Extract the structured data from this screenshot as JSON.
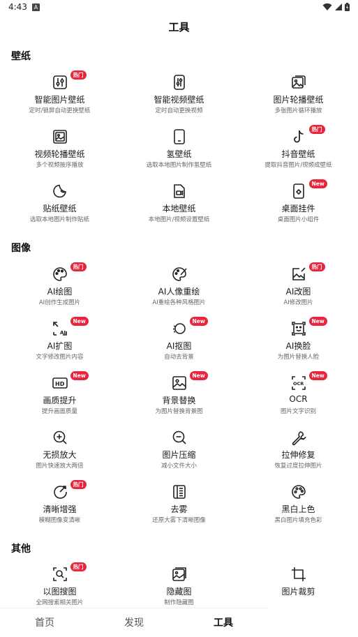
{
  "status": {
    "time": "4:43",
    "notif": "A"
  },
  "page": {
    "title": "工具"
  },
  "sections": {
    "wallpaper": "壁纸",
    "image": "图像",
    "other": "其他"
  },
  "badges": {
    "hot": "热门",
    "new": "New"
  },
  "tools": {
    "smart_pic": {
      "name": "智能图片壁纸",
      "desc": "定时/锁屏自动更换壁纸",
      "icon": "sliders-icon"
    },
    "smart_video": {
      "name": "智能视频壁纸",
      "desc": "定时自动更换视频",
      "icon": "sliders-phone-icon"
    },
    "pic_carousel": {
      "name": "图片轮播壁纸",
      "desc": "多张图片循环播放",
      "icon": "image-stack-icon"
    },
    "video_carousel": {
      "name": "视频轮播壁纸",
      "desc": "多个视频按序播放",
      "icon": "image-frame-icon"
    },
    "hydrogen": {
      "name": "氢壁纸",
      "desc": "选取本地图片制作氢壁纸",
      "icon": "phone-icon"
    },
    "douyin": {
      "name": "抖音壁纸",
      "desc": "提取抖音图片/视频成壁纸",
      "icon": "tiktok-icon"
    },
    "sticker": {
      "name": "贴纸壁纸",
      "desc": "选取本地图片制作贴纸",
      "icon": "sticker-icon"
    },
    "local": {
      "name": "本地壁纸",
      "desc": "本地图片/视频设置壁纸",
      "icon": "local-video-icon"
    },
    "widget": {
      "name": "桌面挂件",
      "desc": "桌面图片小组件",
      "icon": "widget-icon"
    },
    "ai_draw": {
      "name": "AI绘图",
      "desc": "AI创作生成图片",
      "icon": "palette-icon"
    },
    "ai_portrait": {
      "name": "AI人像重绘",
      "desc": "AI重绘各种风格图片",
      "icon": "palette-brush-icon"
    },
    "ai_edit": {
      "name": "AI改图",
      "desc": "AI修改图片",
      "icon": "image-edit-icon"
    },
    "ai_expand": {
      "name": "AI扩图",
      "desc": "文字修改图片内容",
      "icon": "expand-ai-icon"
    },
    "ai_cutout": {
      "name": "AI抠图",
      "desc": "自动去背景",
      "icon": "cutout-icon"
    },
    "ai_faceswap": {
      "name": "AI换脸",
      "desc": "为图片替换人脸",
      "icon": "face-swap-icon"
    },
    "enhance": {
      "name": "画质提升",
      "desc": "提升画面质量",
      "icon": "hd-icon"
    },
    "bg_replace": {
      "name": "背景替换",
      "desc": "为图片替换背景图",
      "icon": "image-icon"
    },
    "ocr": {
      "name": "OCR",
      "desc": "图片文字识别",
      "icon": "ocr-icon"
    },
    "upscale": {
      "name": "无损放大",
      "desc": "图片快速放大两倍",
      "icon": "zoom-in-icon"
    },
    "compress": {
      "name": "图片压缩",
      "desc": "减小文件大小",
      "icon": "zoom-out-icon"
    },
    "stretch_fix": {
      "name": "拉伸修复",
      "desc": "恢复过度拉伸图片",
      "icon": "wrench-icon"
    },
    "sharpen": {
      "name": "清晰增强",
      "desc": "模糊图像变清晰",
      "icon": "clarity-icon"
    },
    "dehaze": {
      "name": "去雾",
      "desc": "还原大雾下清晰图像",
      "icon": "dehaze-icon"
    },
    "colorize": {
      "name": "黑白上色",
      "desc": "黑白图片填充色彩",
      "icon": "color-palette-icon"
    },
    "reverse_search": {
      "name": "以图搜图",
      "desc": "全网搜索相关图片",
      "icon": "image-search-icon"
    },
    "hidden_image": {
      "name": "隐藏图",
      "desc": "制作隐藏图",
      "icon": "hidden-image-icon"
    },
    "crop": {
      "name": "图片裁剪",
      "desc": "",
      "icon": "crop-icon"
    }
  },
  "tabs": {
    "home": "首页",
    "discover": "发现",
    "tools": "工具"
  }
}
